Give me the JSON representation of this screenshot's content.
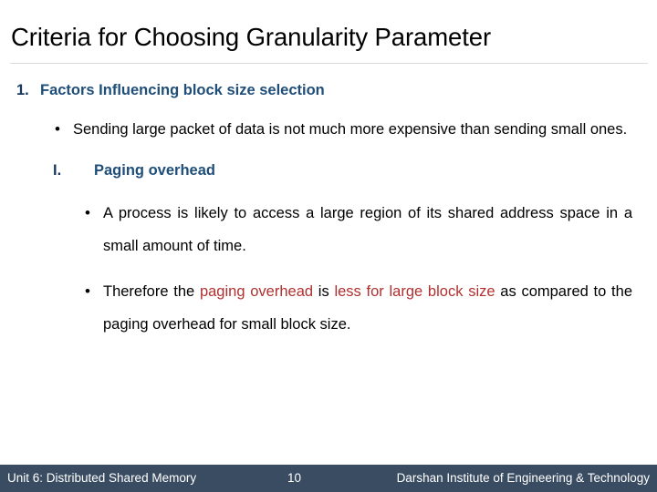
{
  "slide": {
    "title": "Criteria for Choosing Granularity Parameter",
    "outline": {
      "item1": {
        "marker": "1.",
        "heading": "Factors Influencing block size selection",
        "bullet1": "Sending large packet of data is not much more expensive than sending small ones."
      },
      "subitem1": {
        "marker": "I.",
        "heading": "Paging overhead",
        "bullet1": "A process is likely to access a large region of its shared address space in a small amount of time.",
        "bullet2": {
          "part1": "Therefore the ",
          "part2_red": "paging overhead",
          "part3": " is ",
          "part4_red": "less for large block size",
          "part5": " as compared to the paging overhead for small block size."
        }
      }
    }
  },
  "footer": {
    "unit": "Unit 6: Distributed Shared Memory",
    "page": "10",
    "institute": "Darshan Institute of Engineering & Technology"
  },
  "colors": {
    "heading_blue": "#1F4E79",
    "marker_navy": "#17375E",
    "accent_red": "#B03030",
    "footer_bg": "#3A4C61",
    "rule_gray": "#dcdcdc"
  }
}
